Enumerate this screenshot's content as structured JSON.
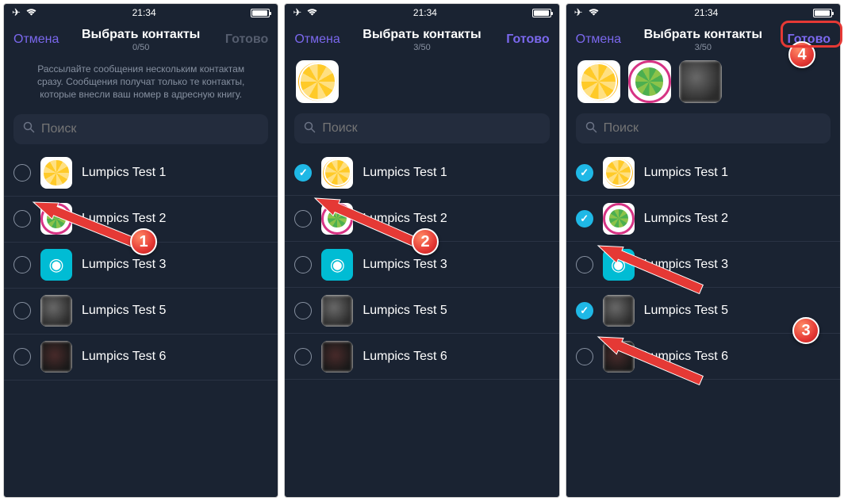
{
  "status": {
    "time": "21:34"
  },
  "nav": {
    "cancel": "Отмена",
    "title": "Выбрать контакты",
    "done": "Готово"
  },
  "info_text": "Рассылайте сообщения нескольким контактам сразу. Сообщения получат только те контакты, которые внесли ваш номер в адресную книгу.",
  "search": {
    "placeholder": "Поиск"
  },
  "screens": [
    {
      "count": "0/50",
      "done_enabled": false,
      "show_info": true,
      "selected_strip": [],
      "checked": []
    },
    {
      "count": "3/50",
      "done_enabled": true,
      "show_info": false,
      "selected_strip": [
        "citrus"
      ],
      "checked": [
        0
      ]
    },
    {
      "count": "3/50",
      "done_enabled": true,
      "show_info": false,
      "selected_strip": [
        "citrus",
        "lime",
        "blur-gray"
      ],
      "checked": [
        0,
        1,
        3
      ]
    }
  ],
  "contacts": [
    {
      "name": "Lumpics Test 1",
      "avatar": "citrus"
    },
    {
      "name": "Lumpics Test 2",
      "avatar": "lime"
    },
    {
      "name": "Lumpics Test 3",
      "avatar": "cyan-bot"
    },
    {
      "name": "Lumpics Test 5",
      "avatar": "blur-gray"
    },
    {
      "name": "Lumpics Test 6",
      "avatar": "blur-dark"
    }
  ],
  "badges": [
    "1",
    "2",
    "3",
    "4"
  ],
  "colors": {
    "accent": "#7b68ee",
    "check": "#1fb8e6",
    "annotation": "#e53935"
  }
}
